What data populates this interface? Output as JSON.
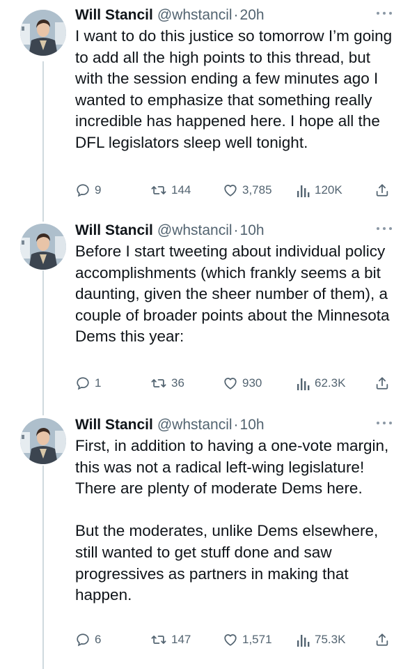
{
  "tweets": [
    {
      "author": "Will Stancil",
      "handle": "@whstancil",
      "separator": "·",
      "time": "20h",
      "paragraphs": [
        "I want to do this justice so tomorrow I’m going to add all the high points to this thread, but with the session ending a few minutes ago I wanted to emphasize that something really incredible has happened here. I hope all the DFL legislators sleep well tonight."
      ],
      "replies": "9",
      "retweets": "144",
      "likes": "3,785",
      "views": "120K"
    },
    {
      "author": "Will Stancil",
      "handle": "@whstancil",
      "separator": "·",
      "time": "10h",
      "paragraphs": [
        "Before I start tweeting about individual policy accomplishments (which frankly seems a bit daunting, given the sheer number of them), a couple of broader points about the Minnesota Dems this year:"
      ],
      "replies": "1",
      "retweets": "36",
      "likes": "930",
      "views": "62.3K"
    },
    {
      "author": "Will Stancil",
      "handle": "@whstancil",
      "separator": "·",
      "time": "10h",
      "paragraphs": [
        "First, in addition to having a one-vote margin, this was not a radical left-wing legislature! There are plenty of moderate Dems here.",
        "But the moderates, unlike Dems elsewhere, still wanted to get stuff done and saw progressives as partners in making that happen."
      ],
      "replies": "6",
      "retweets": "147",
      "likes": "1,571",
      "views": "75.3K"
    }
  ],
  "icons": {
    "reply": "reply-icon",
    "retweet": "retweet-icon",
    "like": "heart-icon",
    "views": "views-chart-icon",
    "share": "share-icon",
    "more": "more-dots-icon"
  },
  "colors": {
    "text": "#0f1419",
    "secondary": "#536471",
    "thread_line": "#cfd9de"
  }
}
